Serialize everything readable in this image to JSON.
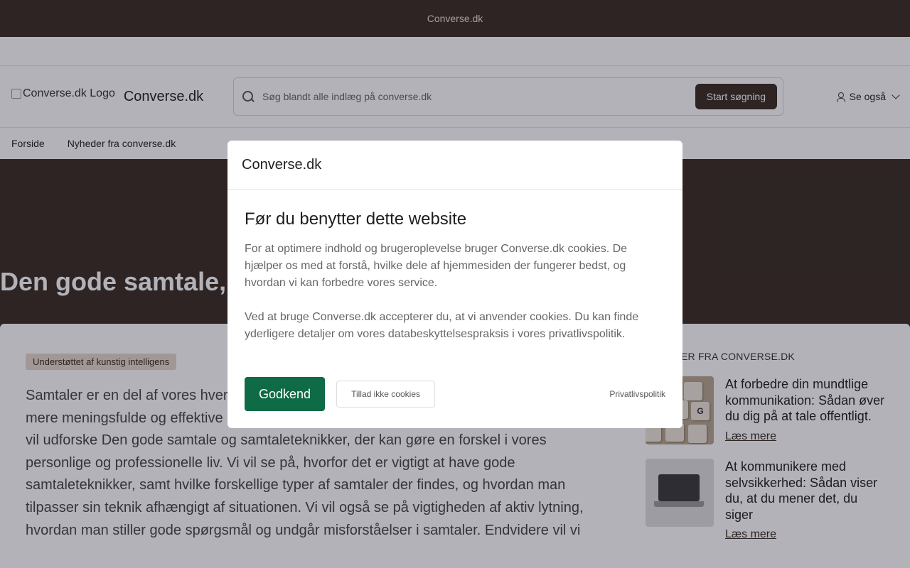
{
  "topbar": {
    "title": "Converse.dk"
  },
  "header": {
    "logo_alt": "Converse.dk Logo",
    "site_name": "Converse.dk",
    "search_placeholder": "Søg blandt alle indlæg på converse.dk",
    "search_button": "Start søgning",
    "see_also": "Se også"
  },
  "nav": {
    "items": [
      "Forside",
      "Nyheder fra converse.dk"
    ]
  },
  "hero": {
    "title": "Den gode samtale, s"
  },
  "article": {
    "badge": "Understøttet af kunstig intelligens",
    "text": "Samtaler er en del af vores hverdag. Men hvad gør en samtale god? Hvordan kan vi føre mere meningsfulde og effektive samtaler? Det er spørgsmål, som denne artikel vil besvare. Vi vil udforske Den gode samtale og samtaleteknikker, der kan gøre en forskel i vores personlige og professionelle liv. Vi vil se på, hvorfor det er vigtigt at have gode samtaleteknikker, samt hvilke forskellige typer af samtaler der findes, og hvordan man tilpasser sin teknik afhængigt af situationen. Vi vil også se på vigtigheden af aktiv lytning, hvordan man stiller gode spørgsmål og undgår misforståelser i samtaler. Endvidere vil vi"
  },
  "sidebar": {
    "title": "ARTIKLER FRA CONVERSE.DK",
    "cards": [
      {
        "title": "At forbedre din mundtlige kommunikation: Sådan øver du dig på at tale offentligt.",
        "link": "Læs mere",
        "thumb_icon": "scrabble-tiles-image"
      },
      {
        "title": "At kommunikere med selvsikkerhed: Sådan viser du, at du mener det, du siger",
        "link": "Læs mere",
        "thumb_icon": "laptop-image"
      }
    ]
  },
  "modal": {
    "header": "Converse.dk",
    "title": "Før du benytter dette website",
    "paragraph1": "For at optimere indhold og brugeroplevelse bruger Converse.dk cookies. De hjælper os med at forstå, hvilke dele af hjemmesiden der fungerer bedst, og hvordan vi kan forbedre vores service.",
    "paragraph2": "Ved at bruge Converse.dk accepterer du, at vi anvender cookies. Du kan finde yderligere detaljer om vores databeskyttelsespraksis i vores privatlivspolitik.",
    "accept": "Godkend",
    "deny": "Tillad ikke cookies",
    "privacy": "Privatlivspolitik"
  },
  "colors": {
    "brand_dark": "#3a2c22",
    "accept_green": "#0f6b45",
    "badge_bg": "#e6d9cd"
  }
}
